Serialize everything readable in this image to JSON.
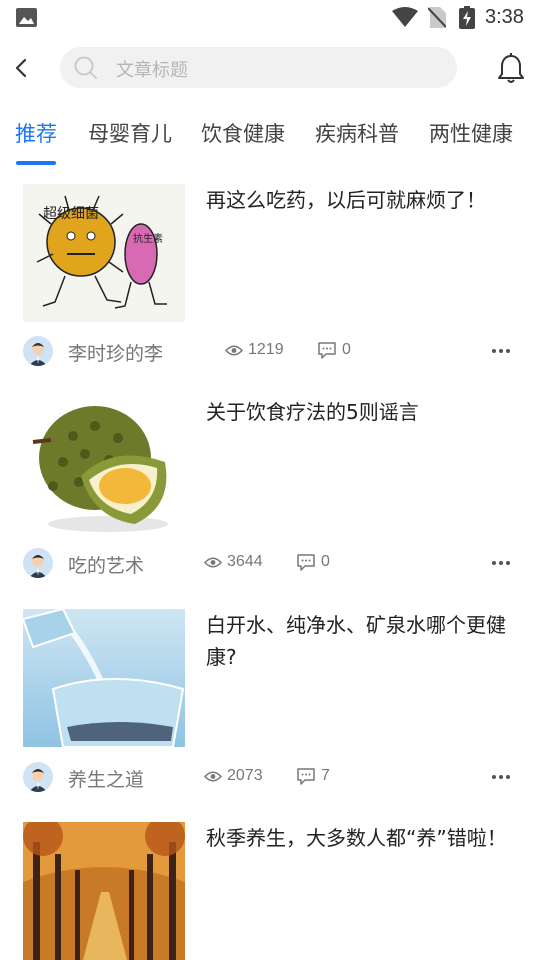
{
  "status_bar": {
    "time": "3:38",
    "icons": [
      "gallery-icon",
      "wifi-icon",
      "no-sim-icon",
      "battery-charging-icon"
    ]
  },
  "header": {
    "search_placeholder": "文章标题",
    "icons": [
      "back-arrow-icon",
      "search-icon",
      "bell-icon"
    ]
  },
  "tabs": [
    {
      "label": "推荐",
      "active": true
    },
    {
      "label": "母婴育儿",
      "active": false
    },
    {
      "label": "饮食健康",
      "active": false
    },
    {
      "label": "疾病科普",
      "active": false
    },
    {
      "label": "两性健康",
      "active": false
    }
  ],
  "articles": [
    {
      "title": "再这么吃药，以后可就麻烦了！",
      "author": "李时珍的李",
      "views": "1219",
      "comments": "0",
      "thumb": "cartoon-germs-image",
      "thumb_text": [
        "超级细菌",
        "抗生素"
      ]
    },
    {
      "title": "关于饮食疗法的5则谣言",
      "author": "吃的艺术",
      "views": "3644",
      "comments": "0",
      "thumb": "durian-image"
    },
    {
      "title": "白开水、纯净水、矿泉水哪个更健康?",
      "author": "养生之道",
      "views": "2073",
      "comments": "7",
      "thumb": "water-glass-image"
    },
    {
      "title": "秋季养生，大多数人都“养”错啦！",
      "thumb": "autumn-trees-image"
    }
  ],
  "colors": {
    "accent": "#1d77f2",
    "text": "#222222",
    "muted": "#777777",
    "search_bg": "#f1f1f2"
  }
}
